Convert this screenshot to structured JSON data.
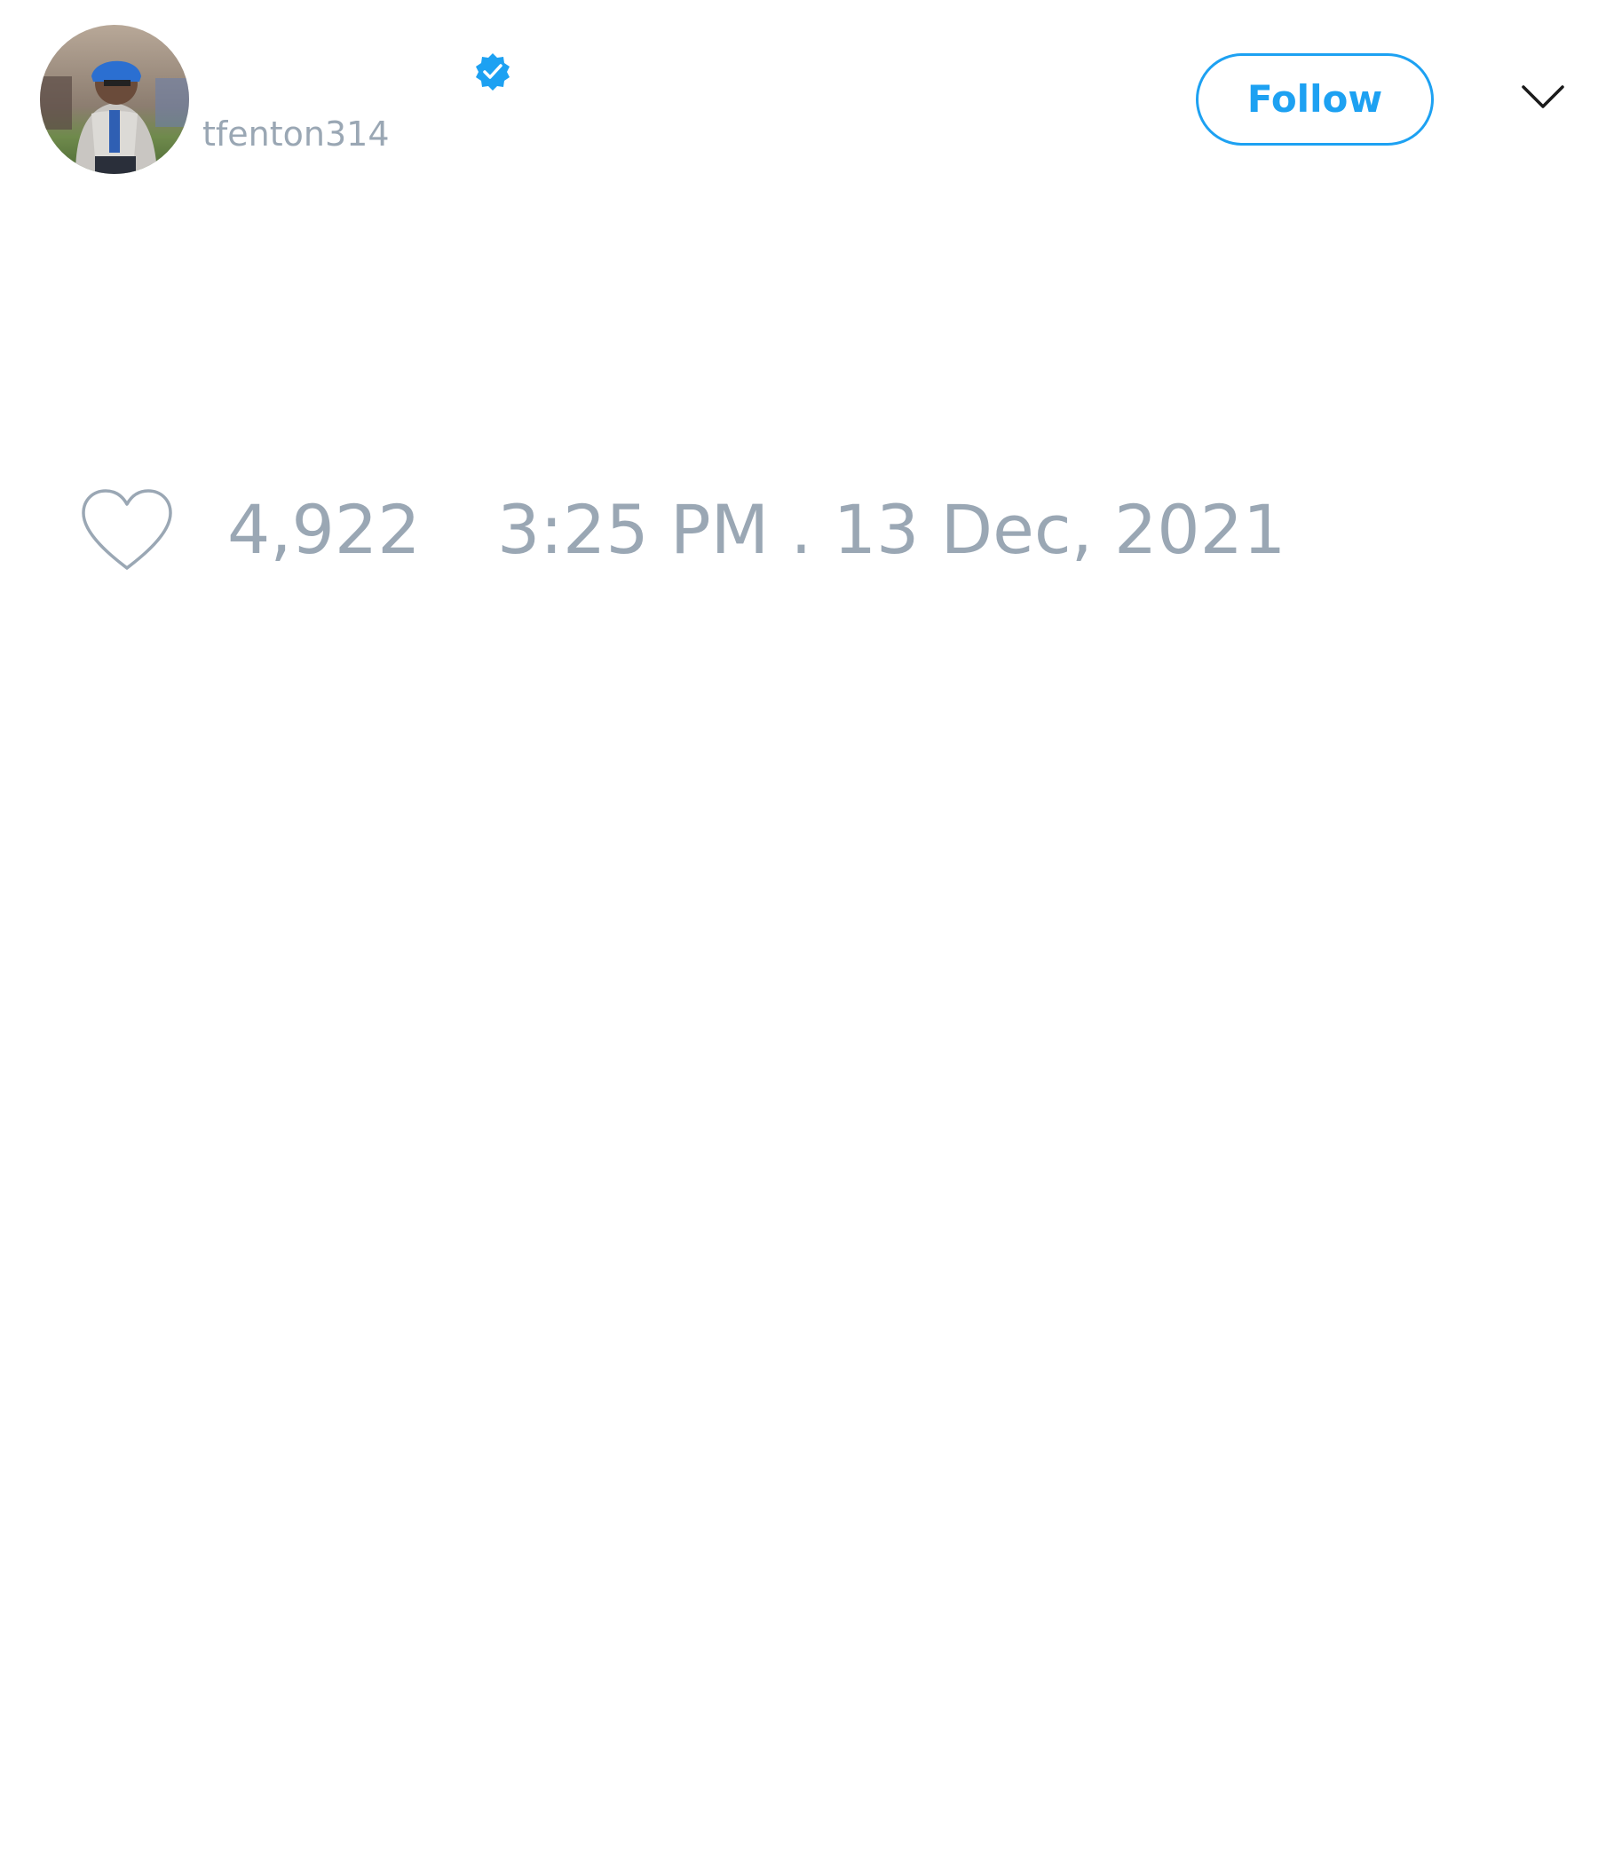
{
  "author": {
    "avatar_icon": "user-avatar-photo",
    "verified_icon": "verified-badge-icon",
    "handle": "tfenton314"
  },
  "header": {
    "follow_label": "Follow",
    "menu_icon": "chevron-down-icon"
  },
  "tweet_footer": {
    "like_icon": "heart-outline-icon",
    "like_count": "4,922",
    "timestamp": "3:25 PM . 13 Dec, 2021"
  },
  "colors": {
    "accent": "#1da1f2",
    "muted_text": "#9aa7b4",
    "background": "#ffffff"
  }
}
